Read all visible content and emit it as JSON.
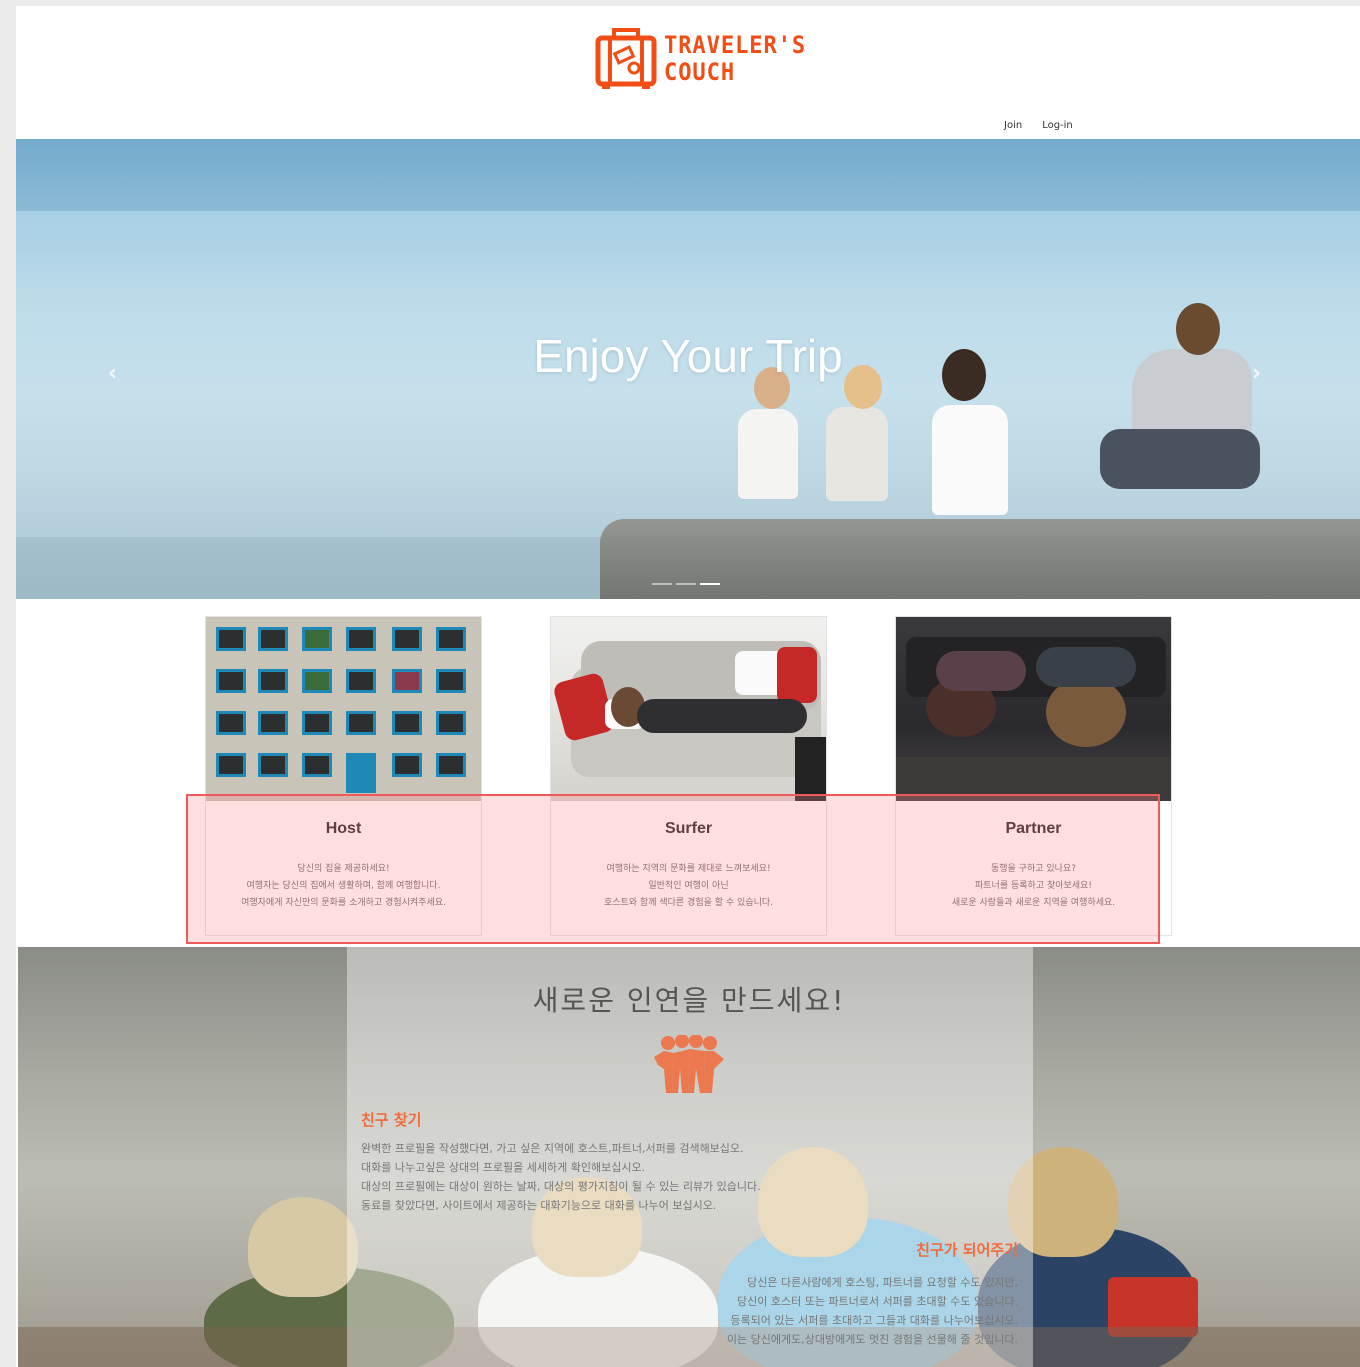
{
  "brand": {
    "line1": "TRAVELER'S",
    "line2": "COUCH",
    "accent": "#f04e14"
  },
  "nav": {
    "join": "Join",
    "login": "Log-in"
  },
  "hero": {
    "title": "Enjoy Your Trip",
    "prev_icon": "chevron-left-icon",
    "next_icon": "chevron-right-icon",
    "slides": 3,
    "active_slide": 3
  },
  "cards": [
    {
      "title": "Host",
      "lines": [
        "당신의 집을 제공하세요!",
        "여행자는 당신의 집에서 생활하며, 함께 여행합니다.",
        "여행자에게 자신만의 문화를 소개하고 경험시켜주세요."
      ]
    },
    {
      "title": "Surfer",
      "lines": [
        "여행하는 지역의 문화를 제대로 느껴보세요!",
        "일반적인 여행이 아닌",
        "호스트와 함께 색다른 경험을 할 수 있습니다."
      ]
    },
    {
      "title": "Partner",
      "lines": [
        "동행을 구하고 있나요?",
        "파트너를 등록하고 찾아보세요!",
        "새로운 사람들과 새로운 지역을 여행하세요."
      ]
    }
  ],
  "lower": {
    "heading": "새로운 인연을 만드세요!",
    "find": {
      "title": "친구 찾기",
      "lines": [
        "완벽한 프로필을 작성했다면, 가고 싶은 지역에 호스트,파트너,서퍼를 검색해보십오.",
        "대화를 나누고싶은 상대의 프로필을 세세하게 확인해보십시오.",
        "대상의 프로필에는 대상이 원하는 날짜, 대상의 평가지침이 될 수 있는 리뷰가 있습니다.",
        "동료를 찾았다면, 사이트에서 제공하는 대화기능으로 대화를 나누어 보십시오."
      ]
    },
    "be": {
      "title": "친구가 되어주기",
      "lines": [
        "당신은 다른사람에게 호스팅, 파트너를 요청할 수도 있지만,",
        "당신이 호스터 또는 파트너로서 서퍼를 초대할 수도 있습니다.",
        "등록되어 있는 서퍼를 초대하고 그들과 대화를 나누어보십시오.",
        "이는 당신에게도,상대방에게도 멋진 경험을 선물해 줄 것입니다."
      ]
    },
    "accent": "#f26a3b"
  }
}
